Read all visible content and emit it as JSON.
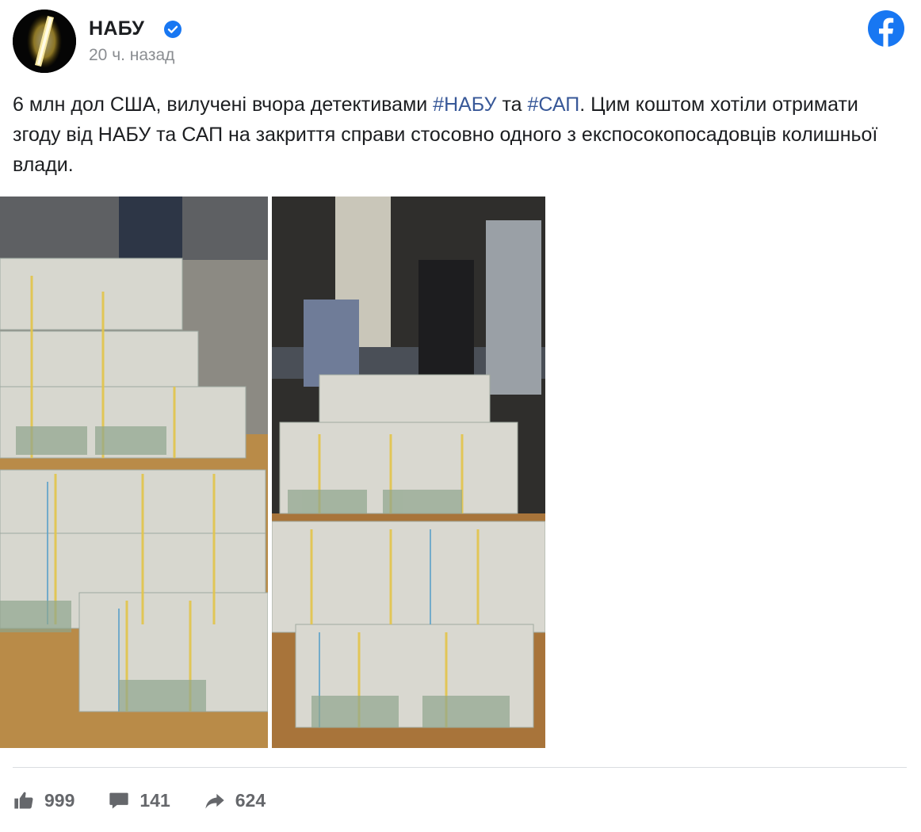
{
  "post": {
    "author": "НАБУ",
    "timestamp": "20 ч. назад",
    "text_before": "6 млн дол США, вилучені вчора детективами ",
    "hashtag1": "#НАБУ",
    "text_middle": " та ",
    "hashtag2": "#САП",
    "text_after": ". Цим коштом хотіли отримати згоду від НАБУ та САП на закриття справи стосовно одного з експосокопосадовців колишньої влади."
  },
  "stats": {
    "likes": "999",
    "comments": "141",
    "shares": "624"
  },
  "colors": {
    "facebook_blue": "#1877f2",
    "hashtag": "#385898",
    "muted": "#65676b"
  },
  "icons": [
    "verified-badge-icon",
    "facebook-logo-icon",
    "like-icon",
    "comment-icon",
    "share-icon"
  ]
}
